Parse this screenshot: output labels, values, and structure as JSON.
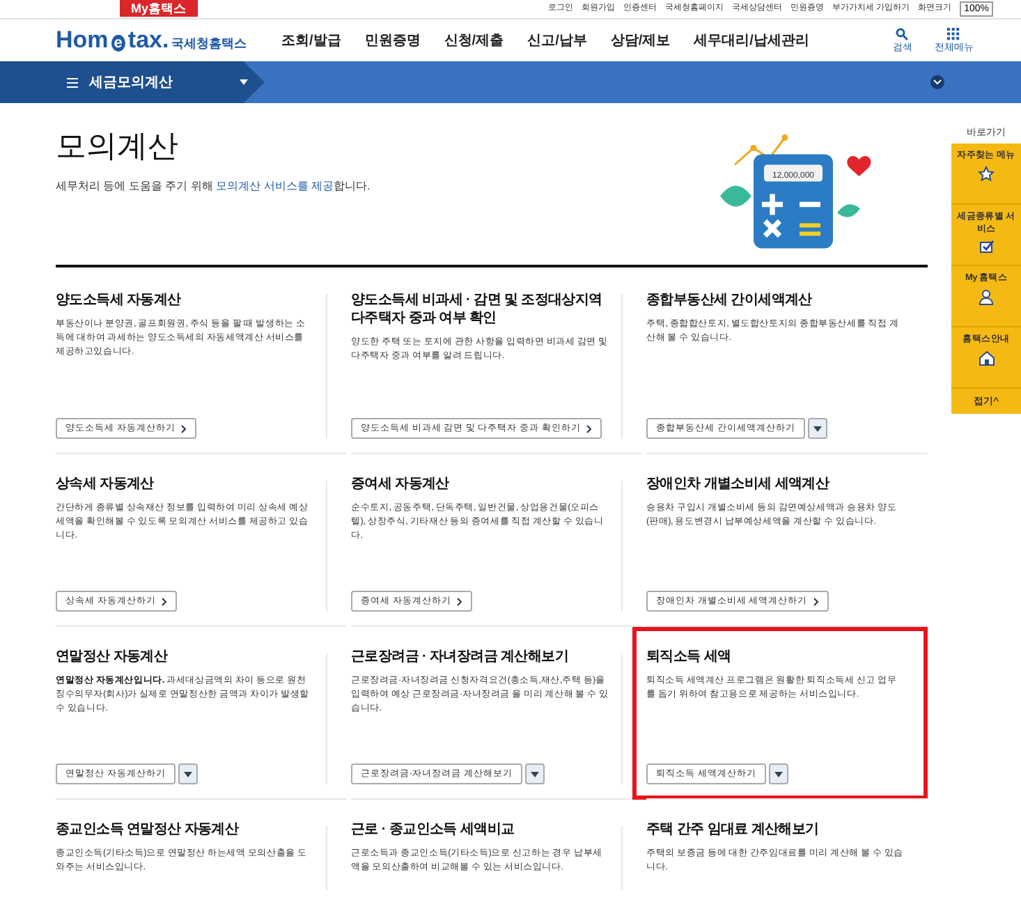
{
  "top_bar": {
    "my_label": "My홈택스",
    "links": [
      "로그인",
      "회원가입",
      "인증센터",
      "국세청홈페이지",
      "국세상담센터",
      "민원증명",
      "부가가치세 가입하기",
      "화면크기"
    ],
    "zoom": "100%"
  },
  "header": {
    "logo_main": "Hom",
    "logo_e": "e",
    "logo_tail": "tax.",
    "logo_name": "국세청홈택스",
    "menu": [
      "조회/발급",
      "민원증명",
      "신청/제출",
      "신고/납부",
      "상담/제보",
      "세무대리/납세관리"
    ],
    "search": "검색",
    "all_menu": "전체메뉴"
  },
  "breadcrumb": {
    "label": "세금모의계산"
  },
  "intro": {
    "title": "모의계산",
    "text": "세무처리 등에 도움을 주기 위해 **모의계산 서비스를 제공**합니다.",
    "display": "12,000,000"
  },
  "cards": [
    {
      "title": "양도소득세 자동계산",
      "text": "부동산이나 분양권, 골프회원권, 주식 등을 팔 때 발생하는 소득에 대하여 과세하는 양도소득세의 자동세액계산 서비스를 제공하고있습니다.",
      "button": "양도소득세 자동계산하기",
      "kind": "link",
      "highlighted": false
    },
    {
      "title": "양도소득세 비과세 · 감면 및 조정대상지역 다주택자 중과 여부 확인",
      "text": "양도한 주택 또는 토지에 관한 사항을 입력하면 비과세 감면 및 다주택자 중과 여부를 알려 드립니다.",
      "button": "양도소득세 비과세 감면 및 다주택자 중과 확인하기",
      "kind": "link",
      "highlighted": false
    },
    {
      "title": "종합부동산세 간이세액계산",
      "text": "주택, 종합합산토지, 별도합산토지의 종합부동산세를 직접 계산해 볼 수 있습니다.",
      "button": "종합부동산세 간이세액계산하기",
      "kind": "dropdown",
      "highlighted": false
    },
    {
      "title": "상속세 자동계산",
      "text": "간단하게 종류별 상속재산 정보를 입력하여 미리 상속세 예상세액을 확인해볼 수 있도록 모의계산 서비스를 제공하고 있습니다.",
      "button": "상속세 자동계산하기",
      "kind": "link",
      "highlighted": false
    },
    {
      "title": "증여세 자동계산",
      "text": "순수토지, 공동주택, 단독주택, 일반건물, 상업용건물(오피스텔), 상장주식, 기타재산 등의 증여세를 직접 계산할 수 있습니다.",
      "button": "증여세 자동계산하기",
      "kind": "link",
      "highlighted": false
    },
    {
      "title": "장애인차 개별소비세 세액계산",
      "text": "승용차 구입시 개별소비세 등의 감면예상세액과 승용차 양도(판매), 용도변경시 납부예상세액을 계산할 수 있습니다.",
      "button": "장애인차 개별소비세 세액계산하기",
      "kind": "link",
      "highlighted": false
    },
    {
      "title": "연말정산 자동계산",
      "text": "**연말정산 자동계산입니다.** 과세대상금액의 차이 등으로 원천징수의무자(회사)가 실제로 연말정산한 금액과 차이가 발생할 수 있습니다.",
      "button": "연말정산 자동계산하기",
      "kind": "dropdown",
      "highlighted": false
    },
    {
      "title": "근로장려금 · 자녀장려금 계산해보기",
      "text": "근로장려금·자녀장려금 신청자격요건(총소득,재산,주택 등)을 입력하여 예상 근로장려금·자녀장려금 을 미리 계산해 볼 수 있습니다.",
      "button": "근로장려금·자녀장려금 계산해보기",
      "kind": "dropdown",
      "highlighted": false
    },
    {
      "title": "퇴직소득 세액",
      "text": "퇴직소득 세액계산 프로그램은 원활한 퇴직소득세 신고 업무를 돕기 위하여 참고용으로 제공하는 서비스입니다.",
      "button": "퇴직소득 세액계산하기",
      "kind": "dropdown",
      "highlighted": true
    },
    {
      "title": "종교인소득 연말정산 자동계산",
      "text": "종교인소득(기타소득)으로 연말정산 하는세액 모의산출을 도와주는 서비스입니다."
    },
    {
      "title": "근로 · 종교인소득 세액비교",
      "text": "근로소득과 종교인소득(기타소득)으로 신고하는 경우 납부세액을 모의산출하여 비교해볼 수 있는 서비스입니다."
    },
    {
      "title": "주택 간주 임대료 계산해보기",
      "text": "주택의 보증금 등에 대한 간주임대료를 미리 계산해 볼 수 있습니다."
    }
  ],
  "quick_menu": {
    "title": "바로가기",
    "items": [
      {
        "label": "자주찾는 메뉴",
        "kind": "star"
      },
      {
        "label": "세금종류별 서비스",
        "kind": "check"
      },
      {
        "label": "My 홈택스",
        "kind": "person"
      },
      {
        "label": "홈택스안내",
        "kind": "guide"
      }
    ],
    "fold": "접기^"
  }
}
